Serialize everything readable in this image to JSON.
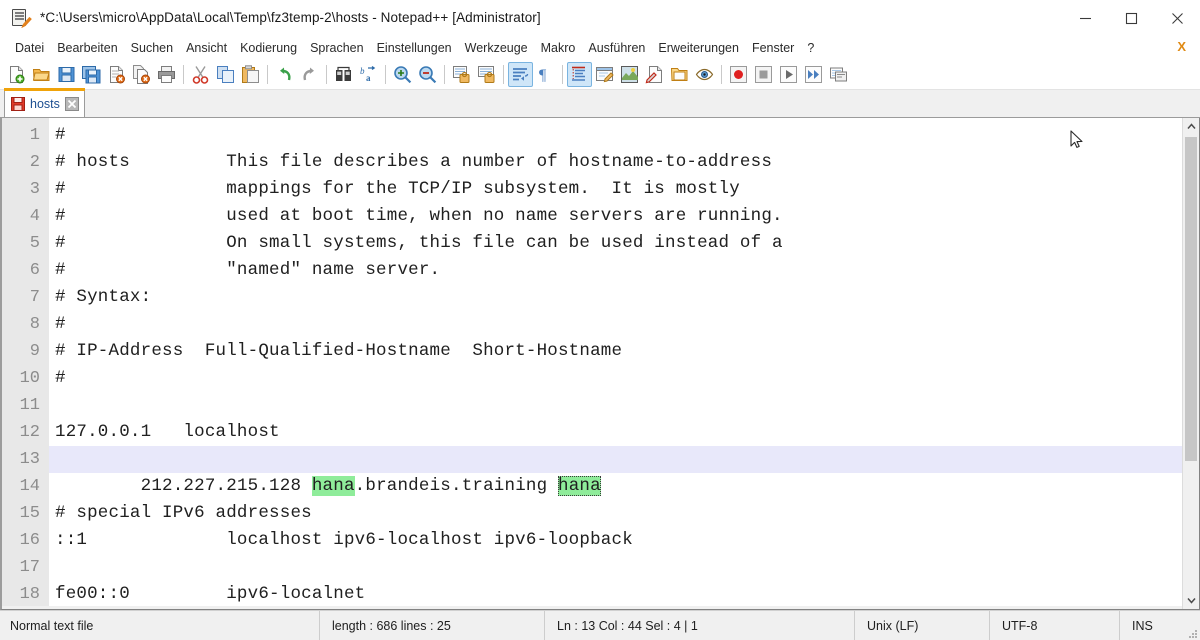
{
  "window": {
    "title": "*C:\\Users\\micro\\AppData\\Local\\Temp\\fz3temp-2\\hosts - Notepad++ [Administrator]",
    "app_icon": "notepad-plus-plus-icon",
    "controls": [
      {
        "name": "minimize-button",
        "glyph": "minimize-icon"
      },
      {
        "name": "maximize-button",
        "glyph": "maximize-icon"
      },
      {
        "name": "close-button",
        "glyph": "close-icon"
      }
    ]
  },
  "menubar": {
    "items": [
      "Datei",
      "Bearbeiten",
      "Suchen",
      "Ansicht",
      "Kodierung",
      "Sprachen",
      "Einstellungen",
      "Werkzeuge",
      "Makro",
      "Ausführen",
      "Erweiterungen",
      "Fenster",
      "?"
    ],
    "close_document_label": "X"
  },
  "toolbar": {
    "groups": [
      [
        "new-file-icon",
        "open-file-icon",
        "save-icon",
        "save-all-icon",
        "close-file-icon",
        "close-all-files-icon",
        "print-icon"
      ],
      [
        "cut-icon",
        "copy-icon",
        "paste-icon"
      ],
      [
        "undo-icon",
        "redo-icon"
      ],
      [
        "find-icon",
        "replace-icon"
      ],
      [
        "zoom-in-icon",
        "zoom-out-icon"
      ],
      [
        "sync-vertical-scrolling-icon",
        "sync-horizontal-scrolling-icon"
      ],
      [
        "word-wrap-icon",
        "show-all-characters-icon"
      ],
      [
        "indent-guideline-icon",
        "user-defined-dialog-icon",
        "show-document-map-icon",
        "function-list-icon",
        "folder-as-workspace-icon",
        "monitoring-icon"
      ],
      [
        "start-recording-icon",
        "stop-recording-icon",
        "playback-icon",
        "run-multiple-times-icon",
        "save-macro-icon"
      ]
    ],
    "active_icons": [
      "word-wrap-icon",
      "indent-guideline-icon"
    ]
  },
  "tabs": [
    {
      "label": "hosts",
      "modified": true,
      "active": true,
      "close_label": "×"
    }
  ],
  "editor": {
    "first_visible_line": 1,
    "current_line": 13,
    "lines": [
      {
        "n": "1",
        "text": "#"
      },
      {
        "n": "2",
        "text": "# hosts         This file describes a number of hostname-to-address"
      },
      {
        "n": "3",
        "text": "#               mappings for the TCP/IP subsystem.  It is mostly"
      },
      {
        "n": "4",
        "text": "#               used at boot time, when no name servers are running."
      },
      {
        "n": "5",
        "text": "#               On small systems, this file can be used instead of a"
      },
      {
        "n": "6",
        "text": "#               \"named\" name server."
      },
      {
        "n": "7",
        "text": "# Syntax:"
      },
      {
        "n": "8",
        "text": "#"
      },
      {
        "n": "9",
        "text": "# IP-Address  Full-Qualified-Hostname  Short-Hostname"
      },
      {
        "n": "10",
        "text": "#"
      },
      {
        "n": "11",
        "text": ""
      },
      {
        "n": "12",
        "text": "127.0.0.1   localhost"
      },
      {
        "n": "13",
        "text": "212.227.215.128 hana.brandeis.training hana",
        "segments": [
          {
            "t": "212.227.215.128 ",
            "style": "plain"
          },
          {
            "t": "hana",
            "style": "highlight"
          },
          {
            "t": ".brandeis.training ",
            "style": "plain"
          },
          {
            "t": "hana",
            "style": "selection"
          }
        ]
      },
      {
        "n": "14",
        "text": ""
      },
      {
        "n": "15",
        "text": "# special IPv6 addresses"
      },
      {
        "n": "16",
        "text": "::1             localhost ipv6-localhost ipv6-loopback"
      },
      {
        "n": "17",
        "text": ""
      },
      {
        "n": "18",
        "text": "fe00::0         ipv6-localnet"
      }
    ]
  },
  "statusbar": {
    "file_type": "Normal text file",
    "length_lines": "length : 686   lines : 25",
    "position": "Ln : 13   Col : 44   Sel : 4 | 1",
    "eol": "Unix (LF)",
    "encoding": "UTF-8",
    "insert_mode": "INS"
  },
  "colors": {
    "tab_accent": "#f0a30a",
    "smart_highlight": "#8fec9a",
    "current_line": "#e8e8fa",
    "gutter": "#e8e8e8",
    "close_doc_x": "#e08a14"
  }
}
